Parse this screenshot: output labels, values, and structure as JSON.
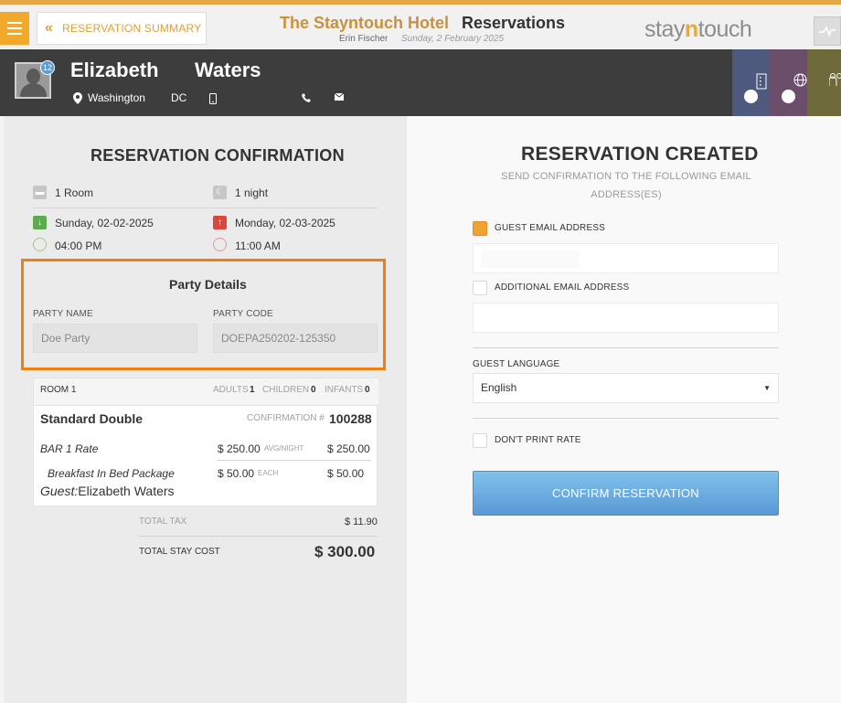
{
  "header": {
    "back_label": "RESERVATION SUMMARY",
    "hotel_name": "The Stayntouch Hotel",
    "page_title": "Reservations",
    "user_name": "Erin Fischer",
    "date": "Sunday, 2 February 2025",
    "logo_pre": "stay",
    "logo_n": "n",
    "logo_post": "touch"
  },
  "guest": {
    "first_name": "Elizabeth",
    "last_name": "Waters",
    "city": "Washington",
    "state": "DC",
    "badge": "12"
  },
  "confirmation": {
    "heading": "RESERVATION CONFIRMATION",
    "rooms": "1 Room",
    "nights": "1 night",
    "arrival_date": "Sunday, 02-02-2025",
    "departure_date": "Monday, 02-03-2025",
    "arrival_time": "04:00 PM",
    "departure_time": "11:00 AM"
  },
  "party": {
    "title": "Party Details",
    "name_label": "PARTY NAME",
    "name_value": "Doe Party",
    "code_label": "PARTY CODE",
    "code_value": "DOEPA250202-125350"
  },
  "room": {
    "label": "ROOM 1",
    "adults_label": "ADULTS",
    "adults": "1",
    "children_label": "CHILDREN",
    "children": "0",
    "infants_label": "INFANTS",
    "infants": "0",
    "type": "Standard Double",
    "confirmation_label": "CONFIRMATION #",
    "confirmation_number": "100288",
    "rate_name": "BAR 1 Rate",
    "rate_price": "$ 250.00",
    "rate_unit": "AVG/NIGHT",
    "rate_total": "$ 250.00",
    "addon_name": "Breakfast In Bed Package",
    "addon_price": "$ 50.00",
    "addon_unit": "EACH",
    "addon_total": "$ 50.00",
    "guest_label": "Guest:",
    "guest_name": "Elizabeth Waters"
  },
  "totals": {
    "tax_label": "TOTAL TAX",
    "tax_value": "$ 11.90",
    "stay_label": "TOTAL STAY COST",
    "stay_value": "$ 300.00"
  },
  "created": {
    "heading": "RESERVATION CREATED",
    "subheading": "SEND CONFIRMATION TO THE FOLLOWING EMAIL ADDRESS(ES)",
    "guest_email_label": "GUEST EMAIL ADDRESS",
    "additional_email_label": "ADDITIONAL EMAIL ADDRESS",
    "language_label": "GUEST LANGUAGE",
    "language_value": "English",
    "dont_print_label": "DON'T PRINT RATE",
    "confirm_label": "CONFIRM RESERVATION"
  },
  "colors": {
    "accent": "#f0a92b",
    "highlight_box": "#f07f11",
    "confirm_button": "#5b98d6",
    "guest_bar": "#3d3d3d"
  },
  "icons": [
    "menu-icon",
    "chevron-double-left-icon",
    "activity-icon",
    "avatar",
    "location-pin-icon",
    "mobile-phone-icon",
    "phone-icon",
    "email-icon",
    "building-icon",
    "globe-icon",
    "people-icon",
    "room-icon",
    "moon-icon",
    "arrival-arrow-icon",
    "departure-arrow-icon",
    "clock-icon",
    "caret-down-icon"
  ]
}
